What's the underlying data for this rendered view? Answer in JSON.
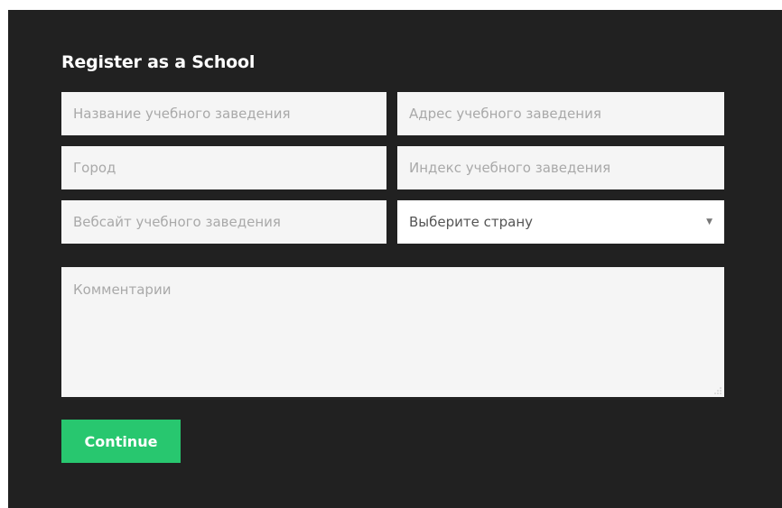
{
  "form": {
    "title": "Register as a School",
    "fields": {
      "school_name": {
        "placeholder": "Название учебного заведения",
        "value": ""
      },
      "school_address": {
        "placeholder": "Адрес учебного заведения",
        "value": ""
      },
      "city": {
        "placeholder": "Город",
        "value": ""
      },
      "postal_code": {
        "placeholder": "Индекс учебного заведения",
        "value": ""
      },
      "website": {
        "placeholder": "Вебсайт учебного заведения",
        "value": ""
      },
      "comments": {
        "placeholder": "Комментарии",
        "value": ""
      }
    },
    "country_select": {
      "selected": "Выберите страну",
      "arrow_icon": "triangle-down-icon"
    },
    "submit_label": "Continue"
  },
  "colors": {
    "panel_background": "#212121",
    "field_background": "#f5f5f5",
    "select_background": "#ffffff",
    "placeholder_text": "#a9a9a9",
    "button_background": "#28c76f",
    "button_text": "#ffffff",
    "title_text": "#ffffff"
  }
}
